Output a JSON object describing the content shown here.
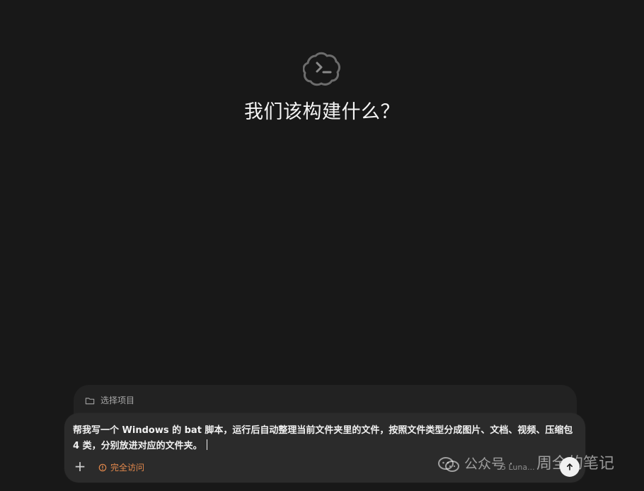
{
  "hero": {
    "title": "我们该构建什么？",
    "icon": "terminal-cloud-icon"
  },
  "project": {
    "label": "选择项目",
    "icon": "folder-icon"
  },
  "composer": {
    "text": "帮我写一个 Windows 的 bat 脚本，运行后自动整理当前文件夹里的文件，按照文件类型分成图片、文档、视频、压缩包 4 类，分别放进对应的文件夹。",
    "access_label": "完全访问",
    "access_color": "#e4894c"
  },
  "toolbar": {
    "plus_icon": "plus-icon",
    "model_label": "5 Luna...",
    "send_icon": "arrow-up-icon"
  },
  "watermark": {
    "channel": "公众号 ·",
    "author": "周全的笔记",
    "icon": "wechat-icon"
  }
}
